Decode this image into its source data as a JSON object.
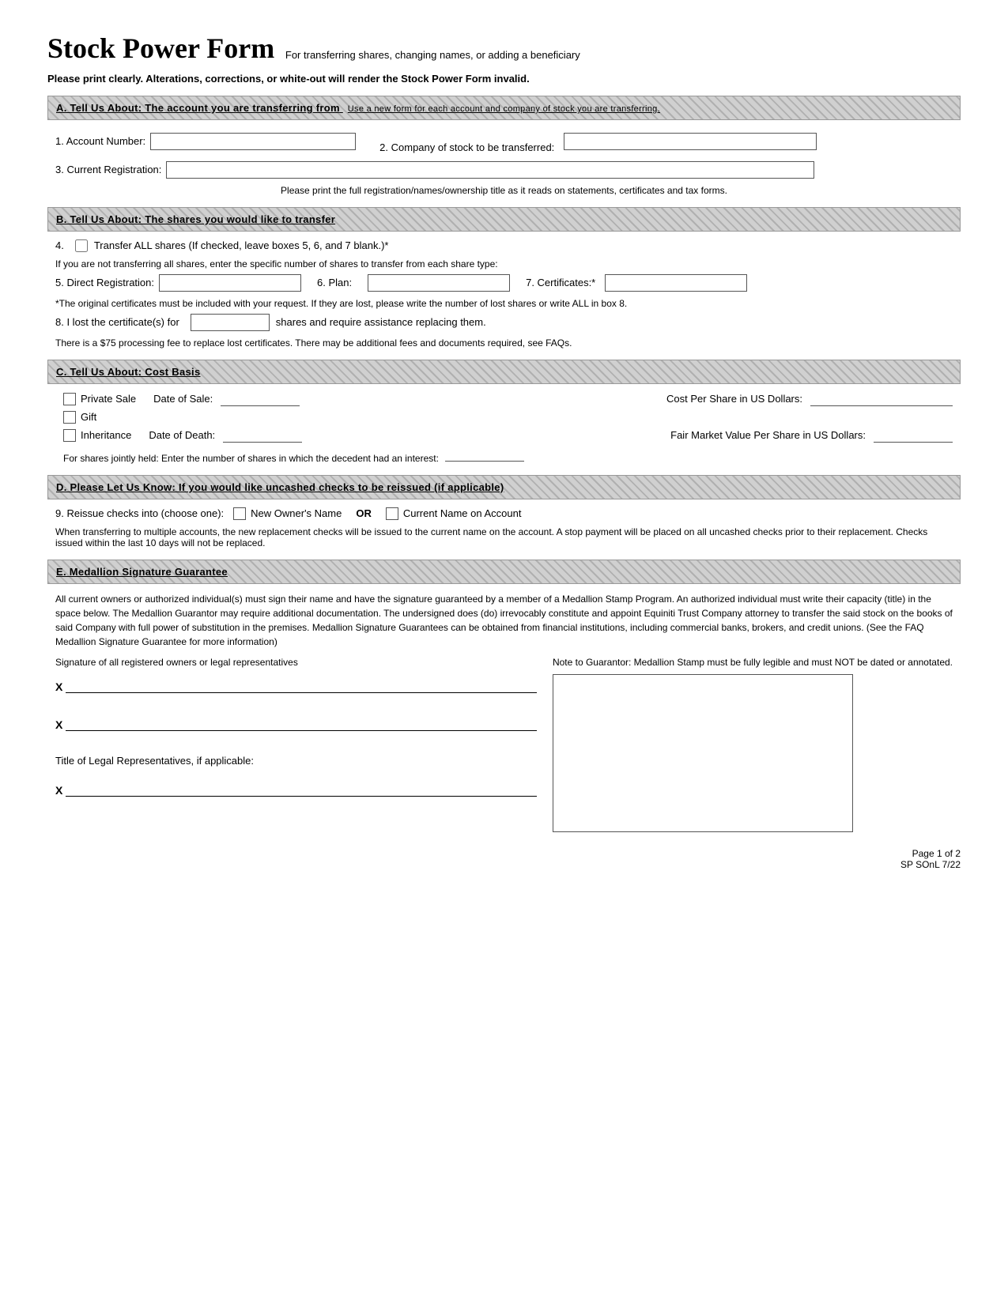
{
  "page": {
    "title": "Stock Power Form",
    "subtitle": "For transferring shares, changing names, or adding a beneficiary",
    "warning": "Please print clearly. Alterations, corrections, or white-out will render the Stock Power Form invalid.",
    "footer_page": "Page 1 of 2",
    "footer_form": "SP SOnL 7/22"
  },
  "section_a": {
    "header": "A. Tell Us About: The account you are transferring from",
    "header_note": "Use a new form for each account and company of stock you are transferring.",
    "field1_label": "1. Account Number:",
    "field2_label": "2. Company of stock to be transferred:",
    "field3_label": "3. Current Registration:",
    "note": "Please print the full registration/names/ownership title as it reads on statements, certificates and tax forms."
  },
  "section_b": {
    "header": "B. Tell Us About: The shares you would like to transfer",
    "item4_label": "Transfer ALL shares (If checked, leave boxes 5, 6, and 7 blank.)*",
    "item4_prefix": "4.",
    "intro_text": "If you are not transferring all shares, enter the specific number of shares to transfer from each share type:",
    "field5_label": "5. Direct Registration:",
    "field6_label": "6. Plan:",
    "field7_label": "7. Certificates:*",
    "note_cert": "*The original certificates must be included with your request. If they are lost, please write the number of lost shares or write ALL in box 8.",
    "field8_label": "8. I lost the certificate(s) for",
    "field8_suffix": "shares and require assistance replacing them.",
    "note_fee": "There is a $75 processing fee to replace lost certificates. There may be additional fees and documents required, see FAQs."
  },
  "section_c": {
    "header": "C. Tell Us About: Cost Basis",
    "private_sale_label": "Private Sale",
    "date_of_sale_label": "Date of Sale:",
    "cost_per_share_label": "Cost Per Share in US Dollars:",
    "gift_label": "Gift",
    "inheritance_label": "Inheritance",
    "date_of_death_label": "Date of Death:",
    "fair_market_label": "Fair Market Value Per Share in US Dollars:",
    "jointly_held_note": "For shares jointly held: Enter the number of shares in which the decedent had an interest:"
  },
  "section_d": {
    "header": "D. Please Let Us Know: If you would like uncashed checks to be reissued (if applicable)",
    "field9_label": "9. Reissue checks into (choose one):",
    "new_owner_label": "New Owner's Name",
    "or_label": "OR",
    "current_name_label": "Current Name on Account",
    "note": "When transferring to multiple accounts, the new replacement checks will be issued to the current name on the account. A stop payment will be placed on all uncashed checks prior to their replacement. Checks issued within the last 10 days will not be replaced."
  },
  "section_e": {
    "header": "E. Medallion Signature Guarantee",
    "para": "All current owners or authorized individual(s) must sign their name and have the signature guaranteed by a member of a Medallion Stamp Program. An authorized individual must write their capacity (title) in the space below. The Medallion Guarantor may require additional documentation. The undersigned does (do) irrevocably constitute and appoint Equiniti Trust Company attorney to transfer the said stock on the books of said Company with full power of substitution in the premises. Medallion Signature Guarantees can be obtained from financial institutions, including commercial banks, brokers, and credit unions. (See the FAQ Medallion Signature Guarantee for more information)",
    "sig_label": "Signature of all registered owners or legal representatives",
    "note_to_guarantor_label": "Note to Guarantor: Medallion Stamp must be fully legible and must NOT be dated or annotated.",
    "title_label": "Title of Legal Representatives, if applicable:",
    "x1": "X",
    "x2": "X",
    "x3": "X"
  }
}
